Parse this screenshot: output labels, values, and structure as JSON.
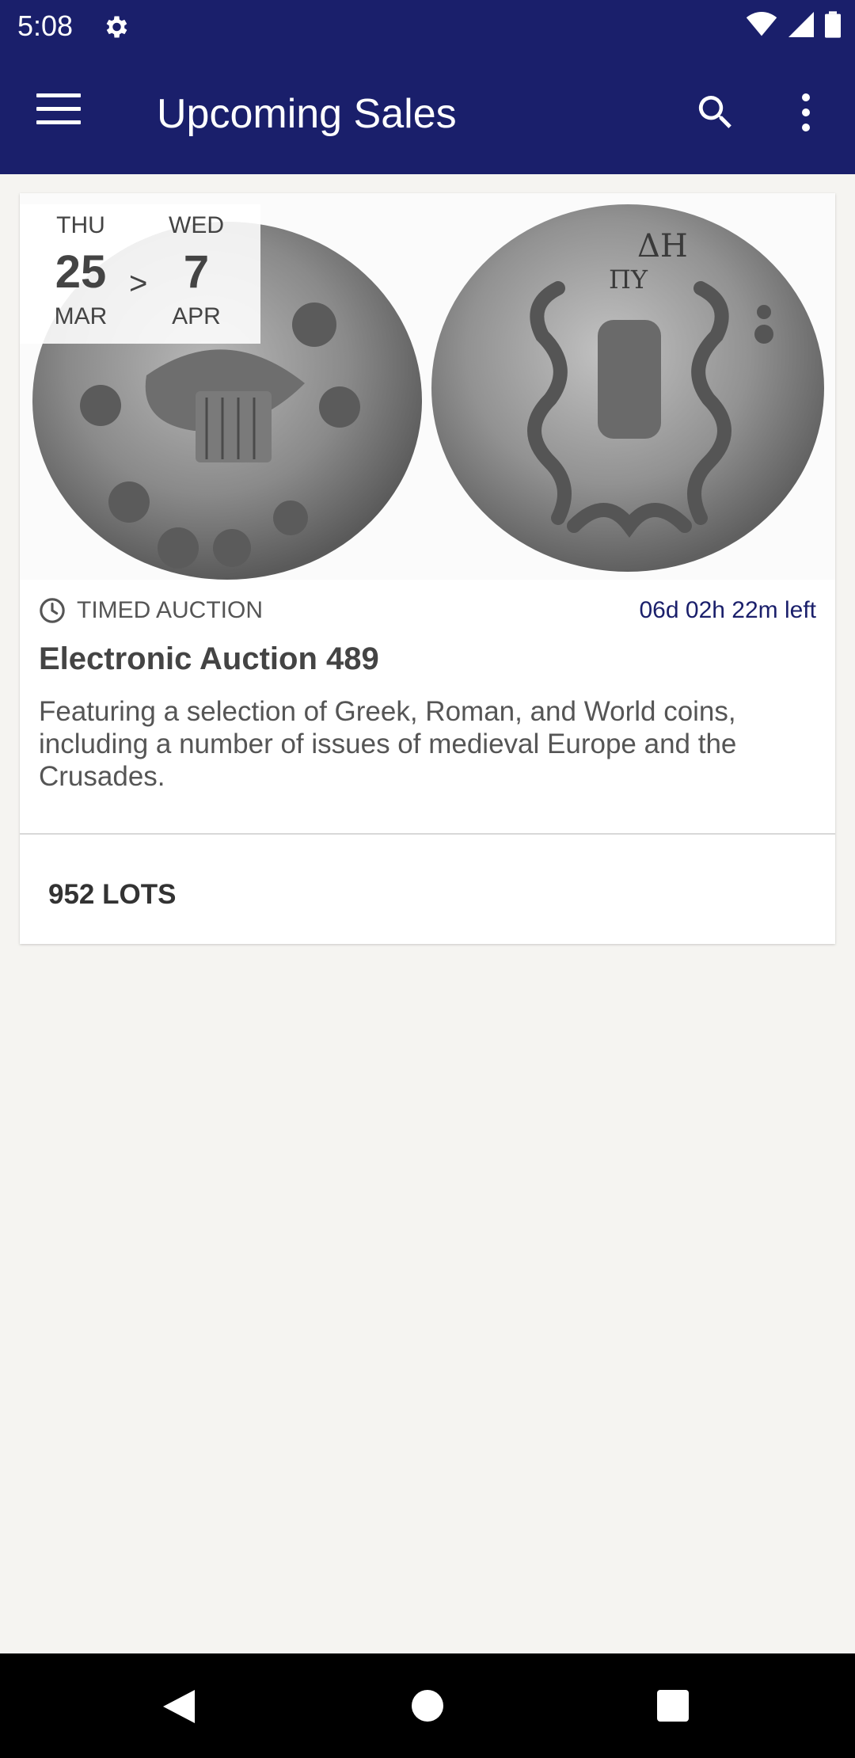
{
  "status_bar": {
    "time": "5:08",
    "icons": [
      "gear-icon",
      "wifi-icon",
      "signal-icon",
      "battery-icon"
    ]
  },
  "app_bar": {
    "title": "Upcoming Sales",
    "icons": [
      "menu-icon",
      "search-icon",
      "more-vert-icon"
    ]
  },
  "sale": {
    "start": {
      "dow": "THU",
      "day": "25",
      "month": "MAR"
    },
    "separator": ">",
    "end": {
      "dow": "WED",
      "day": "7",
      "month": "APR"
    },
    "type": "TIMED AUCTION",
    "time_left": "06d 02h 22m left",
    "title": "Electronic Auction 489",
    "description": "Featuring a selection of Greek, Roman, and World coins, including a number of issues of medieval Europe and the Crusades.",
    "lots": "952 LOTS",
    "image": "coin-image"
  },
  "colors": {
    "primary": "#1a1f6b",
    "background": "#f5f4f1",
    "card": "#ffffff"
  }
}
